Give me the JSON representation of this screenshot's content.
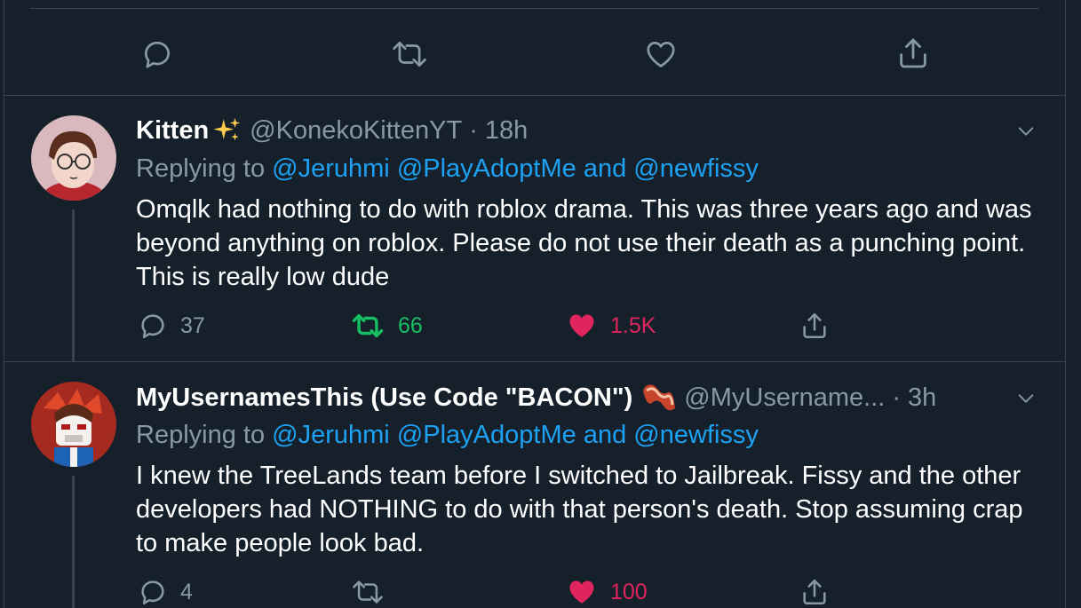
{
  "top_actions": {
    "icons": [
      "reply-icon",
      "retweet-icon",
      "like-icon",
      "share-icon"
    ]
  },
  "tweets": [
    {
      "name": "Kitten",
      "name_emoji": "sparkles",
      "handle": "@KonekoKittenYT",
      "separator": "·",
      "time": "18h",
      "replying_prefix": "Replying to",
      "replying_1": "@Jeruhmi",
      "replying_2": "@PlayAdoptMe",
      "replying_and": "and",
      "replying_3": "@newfissy",
      "text": "Omqlk had nothing to do with roblox drama. This was three years ago and was beyond anything on roblox. Please do not use their death as a punching point. This is really low dude",
      "replies": "37",
      "retweets": "66",
      "likes": "1.5K",
      "retweeted": true,
      "liked": true
    },
    {
      "name": "MyUsernamesThis (Use Code \"BACON\")",
      "name_emoji": "bacon",
      "handle": "@MyUsername...",
      "separator": "·",
      "time": "3h",
      "replying_prefix": "Replying to",
      "replying_1": "@Jeruhmi",
      "replying_2": "@PlayAdoptMe",
      "replying_and": "and",
      "replying_3": "@newfissy",
      "text": "I knew the TreeLands team before I switched to Jailbreak. Fissy and the other developers had NOTHING to do with that person's death. Stop assuming crap to make people look bad.",
      "replies": "4",
      "retweets": "",
      "likes": "100",
      "retweeted": false,
      "liked": true
    }
  ],
  "colors": {
    "background": "#15202b",
    "border": "#38444d",
    "muted": "#8899a6",
    "link": "#1da1f2",
    "retweet": "#17bf63",
    "like": "#e0245e"
  }
}
